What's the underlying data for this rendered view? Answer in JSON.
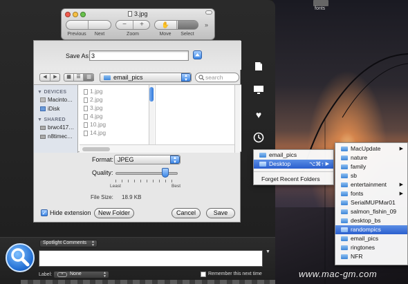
{
  "desktop": {
    "top_icon_label": "fonts",
    "watermark": "www.mac-gm.com"
  },
  "preview": {
    "title": "3.jpg",
    "toolbar": {
      "previous_label": "Previous",
      "next_label": "Next",
      "zoom_label": "Zoom",
      "move_label": "Move",
      "select_label": "Select",
      "overflow_label": "»"
    }
  },
  "save_dialog": {
    "save_as_label": "Save As:",
    "filename_value": "3",
    "location_popup": "email_pics",
    "search_placeholder": "search",
    "sidebar": {
      "devices_header": "DEVICES",
      "devices": [
        "Macinto…",
        "iDisk"
      ],
      "shared_header": "SHARED",
      "shared": [
        "brwc417…",
        "n8timec…"
      ]
    },
    "files": [
      "1.jpg",
      "2.jpg",
      "3.jpg",
      "4.jpg",
      "10.jpg",
      "14.jpg"
    ],
    "format_label": "Format:",
    "format_value": "JPEG",
    "quality_label": "Quality:",
    "quality_min_label": "Least",
    "quality_max_label": "Best",
    "quality_level": 0.8,
    "file_size_label": "File Size:",
    "file_size_value": "18.9 KB",
    "hide_extension_label": "Hide extension",
    "hide_extension_checked": true,
    "new_folder_label": "New Folder",
    "cancel_label": "Cancel",
    "save_label": "Save"
  },
  "recent_menu": {
    "items": [
      "email_pics",
      "Desktop"
    ],
    "desktop_shortcut": "⌥⌘↑",
    "forget_label": "Forget Recent Folders"
  },
  "desktop_submenu": {
    "items": [
      {
        "label": "MacUpdate",
        "has_submenu": true
      },
      {
        "label": "nature",
        "has_submenu": false
      },
      {
        "label": "family",
        "has_submenu": false
      },
      {
        "label": "sb",
        "has_submenu": false
      },
      {
        "label": "entertainment",
        "has_submenu": true
      },
      {
        "label": "fonts",
        "has_submenu": true
      },
      {
        "label": "SerialMUPMar01",
        "has_submenu": false
      },
      {
        "label": "salmon_fishin_09",
        "has_submenu": false
      },
      {
        "label": "desktop_bs",
        "has_submenu": false
      },
      {
        "label": "randompics",
        "has_submenu": false,
        "selected": true
      },
      {
        "label": "email_pics",
        "has_submenu": false
      },
      {
        "label": "ringtones",
        "has_submenu": false
      },
      {
        "label": "NFR",
        "has_submenu": false
      }
    ]
  },
  "spotlight": {
    "comments_popup": "Spotlight Comments",
    "label_label": "Label:",
    "label_value": "None",
    "remember_label": "Remember this next time"
  },
  "colors": {
    "accent_blue": "#2b5fce",
    "panel_dark": "#232323"
  }
}
